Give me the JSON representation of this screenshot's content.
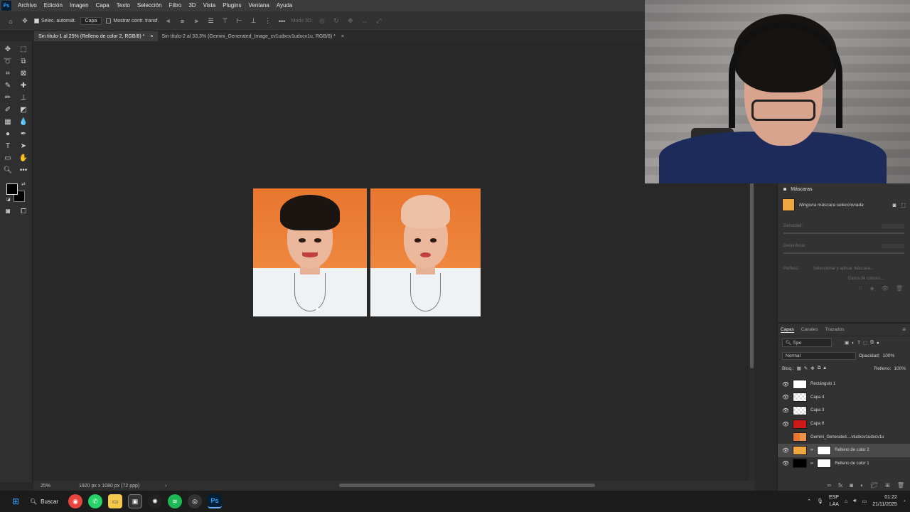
{
  "app": {
    "logo": "Ps"
  },
  "menu": [
    "Archivo",
    "Edición",
    "Imagen",
    "Capa",
    "Texto",
    "Selección",
    "Filtro",
    "3D",
    "Vista",
    "Plugins",
    "Ventana",
    "Ayuda"
  ],
  "options": {
    "auto_select_label": "Selec. automát.",
    "auto_select_target": "Capa",
    "show_transform_label": "Mostrar contr. transf.",
    "mode_3d_label": "Modo 3D:"
  },
  "tabs": [
    {
      "title": "Sin título-1 al 25% (Relleno de color 2, RGB/8) *",
      "active": true
    },
    {
      "title": "Sin título-2 al 33,3% (Gemini_Generated_Image_cv1udxcv1udxcv1u, RGB/8) *",
      "active": false
    }
  ],
  "status": {
    "zoom": "25%",
    "doc_size": "1920 px x 1080 px (72 ppp)"
  },
  "masks_panel": {
    "title": "Máscaras",
    "no_mask": "Ninguna máscara seleccionada",
    "density_label": "Densidad:",
    "feather_label": "Desenfocar:",
    "refine_label": "Perfecc.:",
    "select_mask_btn": "Seleccionar y aplicar máscara...",
    "color_range_btn": "Gama de colores..."
  },
  "layers_panel": {
    "tabs": [
      "Capas",
      "Canales",
      "Trazados"
    ],
    "filter_label": "Tipo",
    "blend_mode": "Normal",
    "opacity_label": "Opacidad:",
    "opacity_value": "100%",
    "lock_label": "Bloq.:",
    "fill_label": "Relleno:",
    "fill_value": "100%",
    "layers": [
      {
        "name": "Rectángulo 1",
        "visible": true,
        "thumb": "white",
        "selected": false,
        "mask": false
      },
      {
        "name": "Capa 4",
        "visible": true,
        "thumb": "check",
        "selected": false,
        "mask": false
      },
      {
        "name": "Capa 3",
        "visible": true,
        "thumb": "check",
        "selected": false,
        "mask": false
      },
      {
        "name": "Capa 6",
        "visible": true,
        "thumb": "red",
        "selected": false,
        "mask": false
      },
      {
        "name": "Gemini_Generated....vtudxcv1udxcv1u",
        "visible": false,
        "thumb": "photo",
        "selected": false,
        "mask": false
      },
      {
        "name": "Relleno de color 2",
        "visible": true,
        "thumb": "orange",
        "selected": true,
        "mask": true
      },
      {
        "name": "Relleno de color 1",
        "visible": true,
        "thumb": "black",
        "selected": false,
        "mask": true
      }
    ]
  },
  "taskbar": {
    "search_label": "Buscar",
    "language": "ESP",
    "region": "LAA",
    "time": "01:22",
    "date": "21/11/2025"
  },
  "colors": {
    "foreground": "#000000",
    "background": "#000000",
    "photo_orange": "#f08a3c",
    "fill_swatch": "#f0a742"
  }
}
